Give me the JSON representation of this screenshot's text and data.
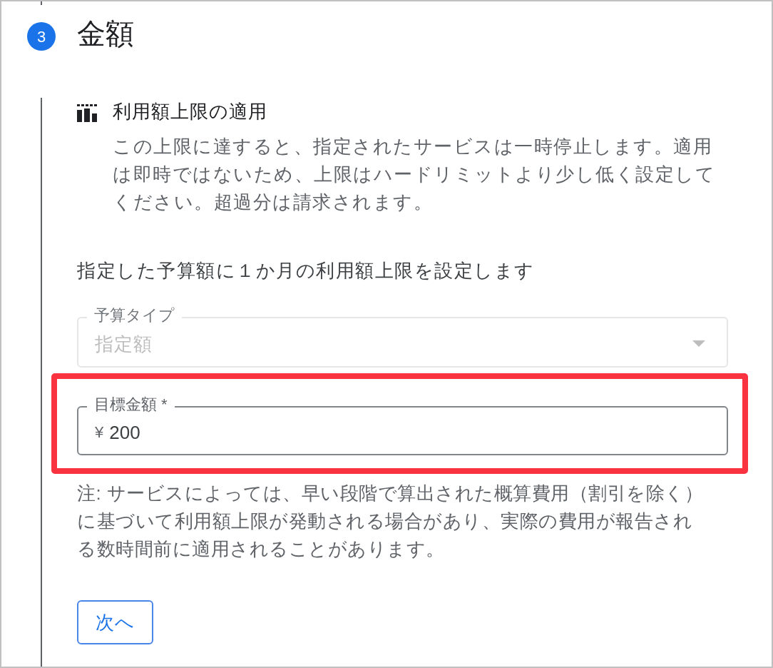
{
  "step": {
    "number": "3",
    "title": "金額"
  },
  "section": {
    "title": "利用額上限の適用",
    "description": "この上限に達すると、指定されたサービスは一時停止します。適用は即時ではないため、上限はハードリミットより少し低く設定してください。超過分は請求されます。"
  },
  "intro": "指定した予算額に１か月の利用額上限を設定します",
  "budget_type": {
    "label": "予算タイプ",
    "value": "指定額",
    "disabled": true
  },
  "target_amount": {
    "label": "目標金額 *",
    "prefix": "¥",
    "value": "200",
    "highlighted": true
  },
  "note": "注: サービスによっては、早い段階で算出された概算費用（割引を除く）に基づいて利用額上限が発動される場合があり、実際の費用が報告される数時間前に適用されることがあります。",
  "buttons": [
    {
      "label": "次へ"
    }
  ]
}
